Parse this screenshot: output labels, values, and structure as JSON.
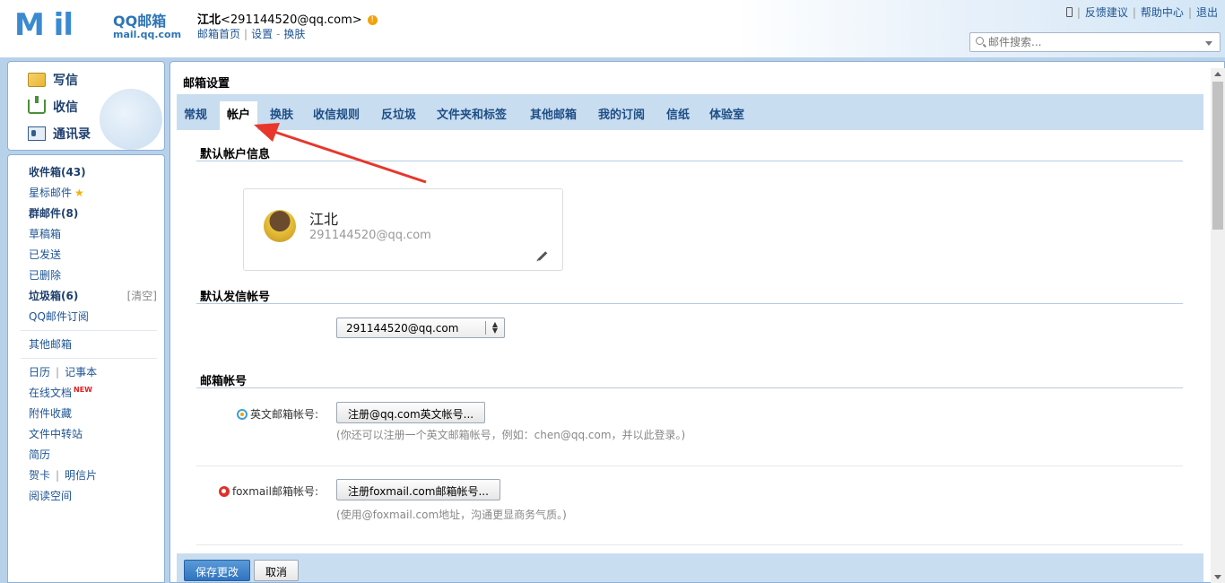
{
  "brand": {
    "logo_big": "M ⁠il",
    "logo_qq": "QQ邮箱",
    "logo_url": "mail.qq.com"
  },
  "user": {
    "name": "江北",
    "email": "<291144520@qq.com>",
    "warn": "!"
  },
  "user_links": [
    "邮箱首页",
    "设置",
    "换肤"
  ],
  "top_links": [
    "反馈建议",
    "帮助中心",
    "退出"
  ],
  "search": {
    "placeholder": "邮件搜索..."
  },
  "side_top": [
    "写信",
    "收信",
    "通讯录"
  ],
  "side": {
    "inbox": "收件箱(43)",
    "starred": "星标邮件",
    "group": "群邮件(8)",
    "drafts": "草稿箱",
    "sent": "已发送",
    "deleted": "已删除",
    "spam": "垃圾箱(6)",
    "spam_clear": "[清空]",
    "subscribe": "QQ邮件订阅",
    "other": "其他邮箱",
    "calendar": "日历",
    "notes": "记事本",
    "docs": "在线文档",
    "docs_badge": "NEW",
    "attachments": "附件收藏",
    "transfer": "文件中转站",
    "resume": "简历",
    "cards": "贺卡",
    "postcards": "明信片",
    "reading": "阅读空间"
  },
  "settings": {
    "title": "邮箱设置",
    "tabs": [
      "常规",
      "帐户",
      "换肤",
      "收信规则",
      "反垃圾",
      "文件夹和标签",
      "其他邮箱",
      "我的订阅",
      "信纸",
      "体验室"
    ],
    "active_tab": "帐户",
    "sec_default_account": "默认帐户信息",
    "card_name": "江北",
    "card_email": "291144520@qq.com",
    "sec_default_sender": "默认发信帐号",
    "sender_value": "291144520@qq.com",
    "sec_mail_accounts": "邮箱帐号",
    "english_label": "英文邮箱帐号:",
    "english_button": "注册@qq.com英文帐号...",
    "english_hint": "(你还可以注册一个英文邮箱帐号，例如：chen@qq.com，并以此登录。)",
    "foxmail_label": "foxmail邮箱帐号:",
    "foxmail_button": "注册foxmail.com邮箱帐号...",
    "foxmail_hint": "(使用@foxmail.com地址，沟通更显商务气质。)",
    "save": "保存更改",
    "cancel": "取消"
  },
  "colors": {
    "accent": "#2f74bf",
    "tab_bar": "#c9ddf0",
    "annotation": "#e8362c"
  }
}
